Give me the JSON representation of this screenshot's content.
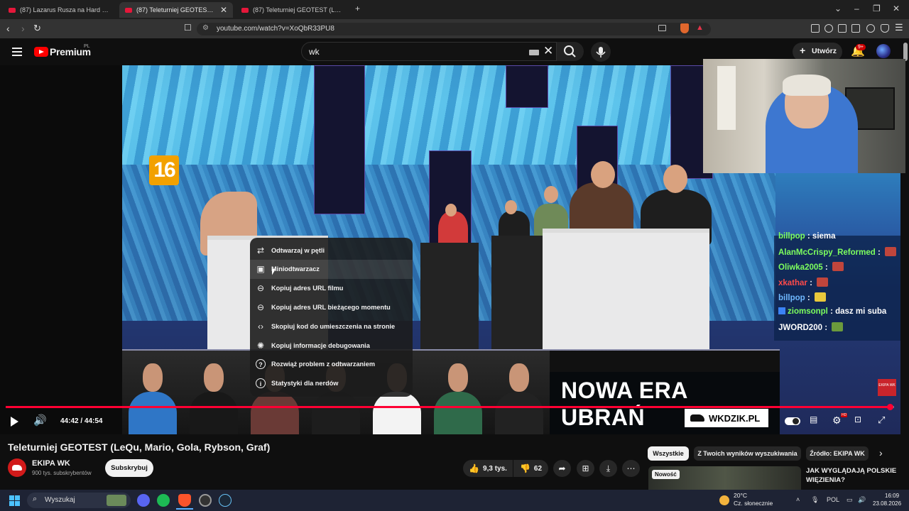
{
  "browser": {
    "tabs": [
      {
        "label": "(87) Lazarus Rusza na Hard Model Th",
        "active": false
      },
      {
        "label": "(87) Teleturniej GEOTEST (LeQu, Ma",
        "active": true
      },
      {
        "label": "(87) Teleturniej GEOTEST (LeQu, Mari",
        "active": false
      }
    ],
    "new_tab": "+",
    "url": "youtube.com/watch?v=XoQbR33PU8"
  },
  "header": {
    "logo_text": "Premium",
    "logo_region": "PL",
    "search_value": "wk",
    "create_label": "Utwórz",
    "notifications_badge": "9+"
  },
  "player": {
    "age_badge": "16",
    "context_menu": [
      {
        "label": "Odtwarzaj w pętli",
        "icon": "loop-icon"
      },
      {
        "label": "Miniodtwarzacz",
        "icon": "miniplayer-icon"
      },
      {
        "label": "Kopiuj adres URL filmu",
        "icon": "link-icon"
      },
      {
        "label": "Kopiuj adres URL bieżącego momentu",
        "icon": "link-icon"
      },
      {
        "label": "Skopiuj kod do umieszczenia na stronie",
        "icon": "embed-icon"
      },
      {
        "label": "Kopiuj informacje debugowania",
        "icon": "debug-icon"
      },
      {
        "label": "Rozwiąż problem z odtwarzaniem",
        "icon": "help-icon"
      },
      {
        "label": "Statystyki dla nerdów",
        "icon": "info-icon"
      }
    ],
    "chat": [
      {
        "name": "billpop",
        "message": "siema",
        "color": "#7dff5e"
      },
      {
        "name": "AlanMcCrispy_Reformed",
        "message": "",
        "color": "#7dff5e"
      },
      {
        "name": "Oliwka2005",
        "message": "",
        "color": "#7dff5e"
      },
      {
        "name": "xkathar",
        "message": "",
        "color": "#ff4a4a"
      },
      {
        "name": "billpop",
        "message": "",
        "color": "#6fb8ff"
      },
      {
        "name": "ziomsonpl",
        "message": "dasz mi suba",
        "color": "#7dff5e"
      },
      {
        "name": "JWORD200",
        "message": "",
        "color": "#ffffff"
      }
    ],
    "ad": {
      "line1": "NOWA ERA",
      "line2": "UBRAŃ",
      "site": "WKDZIK.PL",
      "corner": "EKIPA WK"
    },
    "time": "44:42 / 44:54",
    "progress": 0.9955
  },
  "video": {
    "title": "Teleturniej GEOTEST (LeQu, Mario, Gola, Rybson, Graf)",
    "channel": "EKIPA WK",
    "subscribers": "900 tys. subskrybentów",
    "subscribe_label": "Subskrybuj",
    "likes": "9,3 tys.",
    "dislikes": "62"
  },
  "filters": [
    "Wszystkie",
    "Z Twoich wyników wyszukiwania",
    "Źródło: EKIPA WK"
  ],
  "recommendation": {
    "badge": "Nowość",
    "title": "JAK WYGLĄDAJĄ POLSKIE WIĘZIENIA?"
  },
  "taskbar": {
    "search_placeholder": "Wyszukaj",
    "weather_temp": "20°C",
    "weather_desc": "Cz. słonecznie",
    "language": "POL",
    "time": "16:09",
    "date": "23.08.2026"
  }
}
